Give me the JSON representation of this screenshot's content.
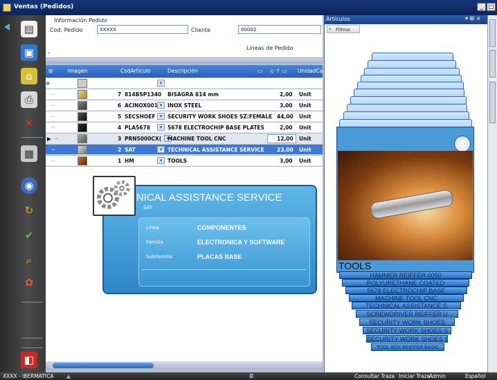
{
  "window": {
    "title": "Ventas (Pedidos)",
    "buttons": [
      "_",
      "□",
      "×"
    ]
  },
  "sidebar": {
    "icons": [
      "new-document-icon",
      "save-icon",
      "trash-icon",
      "print-icon",
      "delete-icon",
      "calculator-icon",
      "globe-icon",
      "refresh-icon",
      "check-icon",
      "search-icon",
      "tools-icon",
      "pdf-icon"
    ]
  },
  "pedido": {
    "section_label": "Información Pedido",
    "cod_label": "Cod. Pedido",
    "cod_value": "XXXXX",
    "cliente_label": "Cliente",
    "cliente_value": "00002",
    "lineas_label": "Líneas de Pedido"
  },
  "grid": {
    "headers": {
      "imagen": "Imagen",
      "codarticulo": "CodArticulo",
      "descripcion": "Descripción",
      "unidad": "UnidadCa"
    },
    "rows": [
      {
        "num": "",
        "code": "",
        "desc": "",
        "qty": "",
        "unit": ""
      },
      {
        "num": "7",
        "code": "814BSP1340",
        "desc": "BISAGRA 814 mm",
        "qty": "2,00",
        "unit": "Unit"
      },
      {
        "num": "6",
        "code": "ACINOX001",
        "desc": "INOX STEEL",
        "qty": "3,00",
        "unit": "Unit"
      },
      {
        "num": "5",
        "code": "SECSHOEF",
        "desc": "SECURITY WORK SHOES SZ:FEMALE",
        "qty": "44,00",
        "unit": "Unit"
      },
      {
        "num": "4",
        "code": "PLA5678",
        "desc": "5678 ELECTROCHIP BASE PLATES",
        "qty": "2,00",
        "unit": "Unit"
      },
      {
        "num": "3",
        "code": "PRN5000CX(",
        "desc": "MACHINE TOOL CNC",
        "qty": "12,00",
        "unit": "Unit"
      },
      {
        "num": "2",
        "code": "SAT",
        "desc": "TECHNICAL ASSISTANCE SERVICE",
        "qty": "23,00",
        "unit": "Unit"
      },
      {
        "num": "1",
        "code": "HM",
        "desc": "TOOLS",
        "qty": "3,00",
        "unit": "Unit"
      }
    ]
  },
  "card": {
    "title": "TECHNICAL ASSISTANCE SERVICE",
    "code": "SAT",
    "linea_label": "Línea",
    "linea_value": "COMPONENTES",
    "familia_label": "Familia",
    "familia_value": "ELECTRONICA Y SOFTWARE",
    "subfamilia_label": "SubFamilia",
    "subfamilia_value": "PLACAS BASE"
  },
  "articulos": {
    "title": "Artículos",
    "filtros": "Filtros",
    "hero_title": "TOOLS",
    "stack_labels": [
      "HAMMER REIFFER 0050",
      "POLYURETHANE COATED",
      "5678 ELECTROCHIP BASE",
      "MACHINE TOOL CNC",
      "TECHNICAL ASSISTANCE S",
      "SCREWDRIVER REIFFER U",
      "SECURITY WORK SHOES",
      "SECURITY WORK SHOES S",
      "SECURITY WORK SHOES S",
      "TOOL BOX REIFFER BASIC"
    ]
  },
  "statusbar": {
    "left": "XXXX - IBERMATICA",
    "consultar": "Consultar Traza",
    "iniciar": "Iniciar Traza",
    "admin": "Admin",
    "idioma": "Español"
  },
  "colors": {
    "accent": "#3c78d4",
    "card": "#2f86c8",
    "titlebar": "#14367a"
  }
}
